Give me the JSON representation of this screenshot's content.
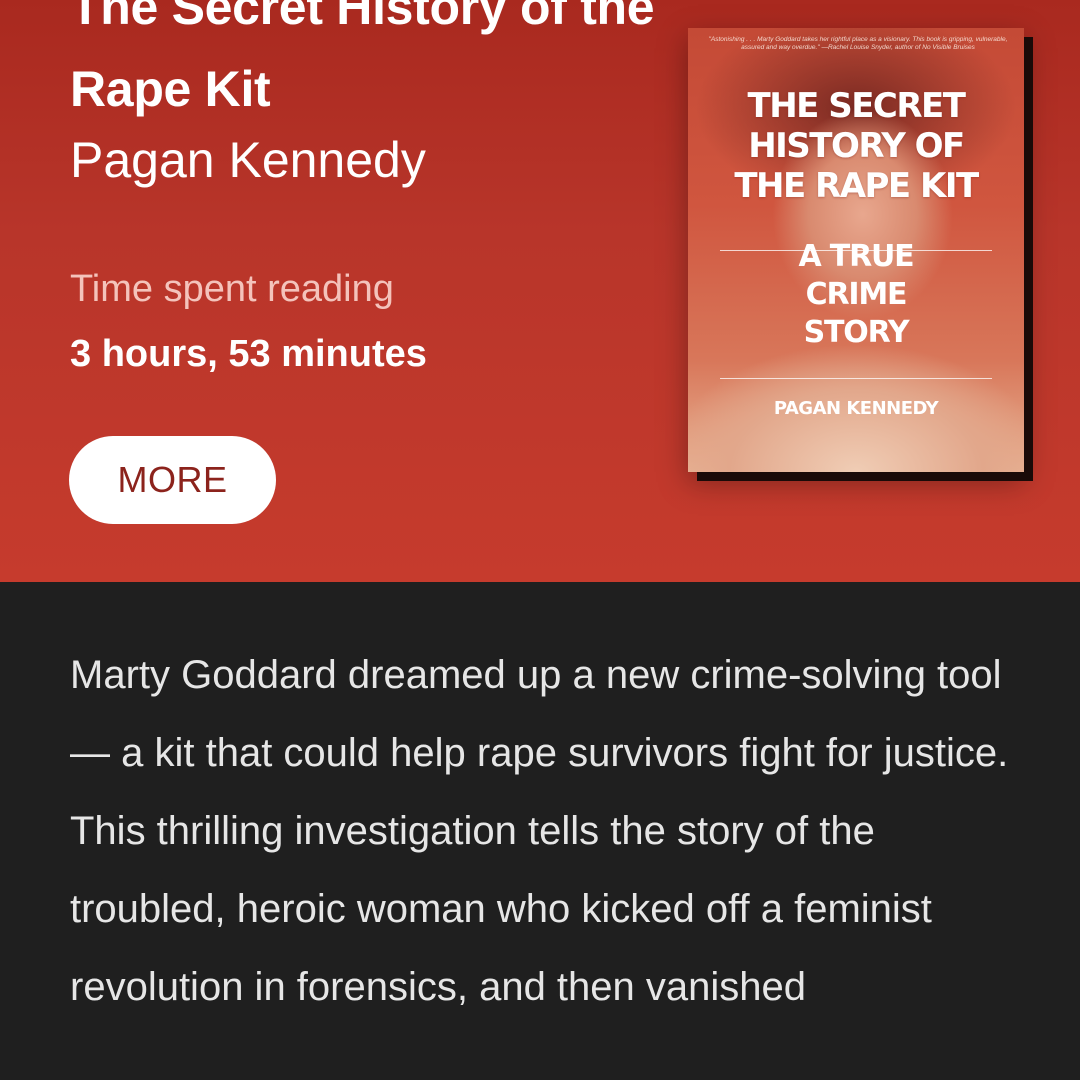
{
  "book": {
    "title": "The Secret History of the Rape Kit",
    "author": "Pagan Kennedy"
  },
  "reading_stats": {
    "label": "Time spent reading",
    "value": "3 hours, 53 minutes"
  },
  "actions": {
    "more_label": "MORE"
  },
  "cover": {
    "blurb": "\"Astonishing . . . Marty Goddard takes her rightful place as a visionary. This book is gripping, vulnerable, assured and way overdue.\" —Rachel Louise Snyder, author of No Visible Bruises",
    "title": "THE SECRET HISTORY OF THE RAPE KIT",
    "subtitle": "A TRUE CRIME STORY",
    "author": "PAGAN KENNEDY"
  },
  "description": "Marty Goddard dreamed up a new crime-solving tool — a kit that could help rape survivors fight for justice. This thrilling investigation tells the story of the troubled, heroic woman who kicked off a feminist revolution in forensics, and then vanished",
  "colors": {
    "header_red": "#b8352a",
    "body_background": "#1f1f1f",
    "button_text": "#8c231c"
  }
}
